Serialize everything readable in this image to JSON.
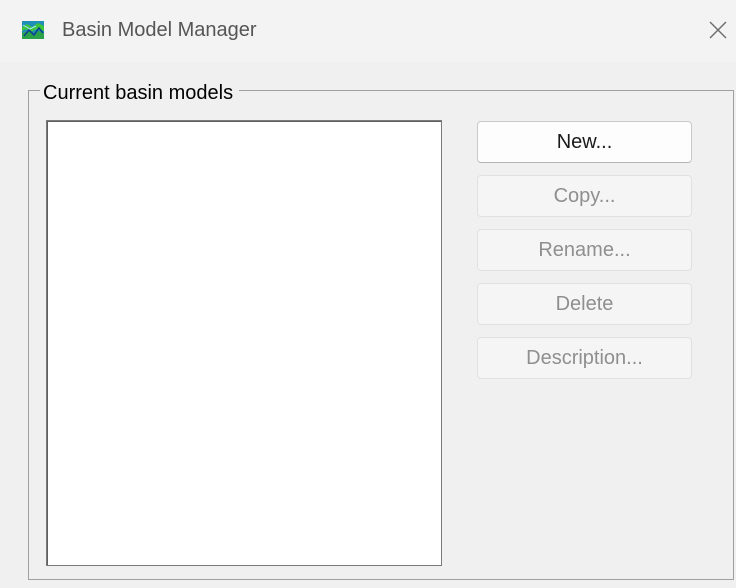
{
  "window": {
    "title": "Basin Model Manager",
    "icon": "hec-hms-basin-icon",
    "close_icon": "close-icon"
  },
  "group": {
    "label": "Current basin models"
  },
  "basin_models": [],
  "buttons": {
    "new": {
      "label": "New...",
      "enabled": true
    },
    "copy": {
      "label": "Copy...",
      "enabled": false
    },
    "rename": {
      "label": "Rename...",
      "enabled": false
    },
    "delete": {
      "label": "Delete",
      "enabled": false
    },
    "description": {
      "label": "Description...",
      "enabled": false
    }
  },
  "colors": {
    "background": "#f0f0f0",
    "titlebar": "#f3f3f3",
    "disabled_text": "#8f8f8f",
    "enabled_text": "#1a1a1a"
  }
}
